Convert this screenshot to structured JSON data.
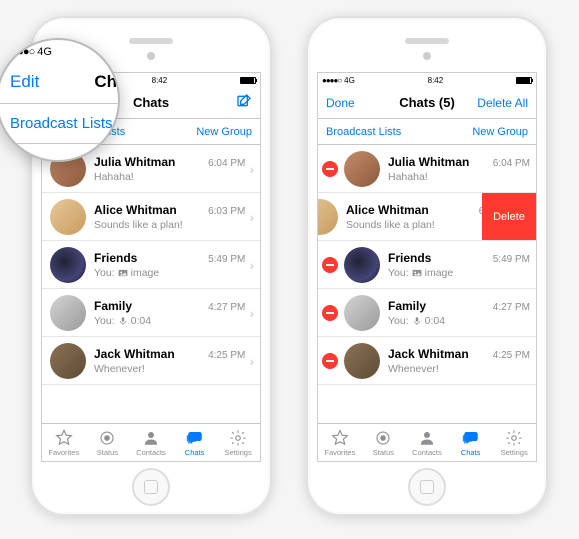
{
  "status": {
    "carrier": "4G",
    "time": "8:42",
    "battery_pct": 95,
    "signal_dots": "●●●●○"
  },
  "left": {
    "nav": {
      "left": "Edit",
      "title": "Chats",
      "right_icon": "compose-icon"
    },
    "sub": {
      "left": "Broadcast Lists",
      "right": "New Group"
    }
  },
  "right": {
    "nav": {
      "left": "Done",
      "title": "Chats (5)",
      "right": "Delete All"
    },
    "sub": {
      "left": "Broadcast Lists",
      "right": "New Group"
    },
    "swipe_delete_label": "Delete"
  },
  "chats": [
    {
      "name": "Julia Whitman",
      "preview": "Hahaha!",
      "time": "6:04 PM",
      "icon": null
    },
    {
      "name": "Alice Whitman",
      "preview": "Sounds like a plan!",
      "time": "6:03 PM",
      "icon": null
    },
    {
      "name": "Friends",
      "preview_prefix": "You:",
      "preview": "image",
      "time": "5:49 PM",
      "icon": "photo-icon"
    },
    {
      "name": "Family",
      "preview_prefix": "You:",
      "preview": "0:04",
      "time": "4:27 PM",
      "icon": "mic-icon"
    },
    {
      "name": "Jack Whitman",
      "preview": "Whenever!",
      "time": "4:25 PM",
      "icon": null
    }
  ],
  "tabs": [
    {
      "label": "Favorites",
      "icon": "star-icon"
    },
    {
      "label": "Status",
      "icon": "status-icon"
    },
    {
      "label": "Contacts",
      "icon": "contact-icon"
    },
    {
      "label": "Chats",
      "icon": "chats-icon"
    },
    {
      "label": "Settings",
      "icon": "gear-icon"
    }
  ],
  "colors": {
    "accent": "#007aff",
    "destructive": "#ff3b30",
    "muted": "#8e8e93"
  }
}
